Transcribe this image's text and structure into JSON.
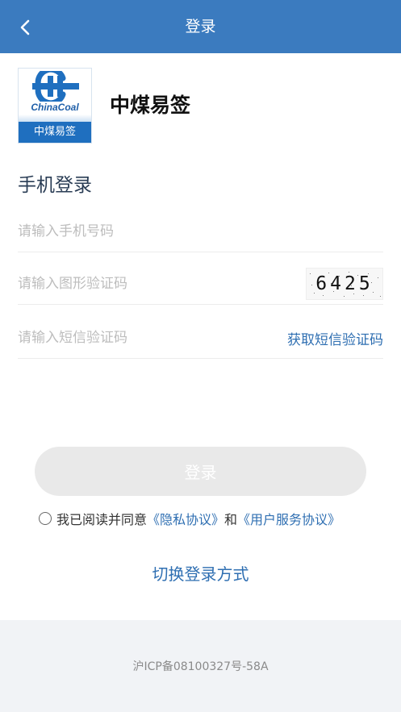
{
  "header": {
    "title": "登录",
    "back_icon": "chevron-left-icon",
    "bg_color": "#3b7bbf"
  },
  "logo": {
    "brand_text": "ChinaCoal",
    "badge_text": "中煤易签",
    "mark_icon": "chinacoal-logo-mark"
  },
  "app_name": "中煤易签",
  "section_title": "手机登录",
  "form": {
    "phone": {
      "value": "",
      "placeholder": "请输入手机号码"
    },
    "captcha": {
      "value": "",
      "placeholder": "请输入图形验证码",
      "image_text": "6425"
    },
    "sms": {
      "value": "",
      "placeholder": "请输入短信验证码",
      "get_code_label": "获取短信验证码"
    }
  },
  "login_button_label": "登录",
  "agreement": {
    "prefix": "我已阅读并同意",
    "privacy_link": "《隐私协议》",
    "and": "和",
    "service_link": "《用户服务协议》",
    "checked": false
  },
  "switch_mode_label": "切换登录方式",
  "footer": {
    "icp": "沪ICP备08100327号-58A"
  },
  "colors": {
    "accent": "#2f6fb2",
    "button_disabled": "#e9e9e9",
    "footer_bg": "#f1f3f6"
  }
}
